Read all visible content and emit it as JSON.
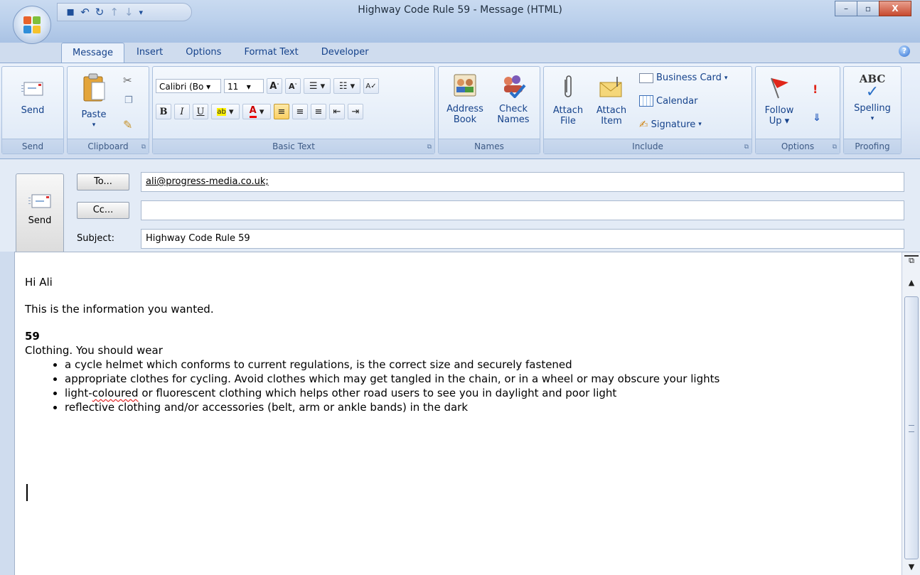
{
  "window": {
    "title": "Highway Code Rule 59 - Message (HTML)",
    "controls": {
      "minimize": "–",
      "maximize": "▫",
      "close": "X"
    }
  },
  "quick_access": {
    "save": "▪",
    "undo": "↶",
    "redo": "↻",
    "up": "↑",
    "down": "↓",
    "more": "▾"
  },
  "tabs": [
    "Message",
    "Insert",
    "Options",
    "Format Text",
    "Developer"
  ],
  "ribbon": {
    "send_group": {
      "send": "Send",
      "label": "Send"
    },
    "clipboard": {
      "paste": "Paste",
      "label": "Clipboard"
    },
    "basic_text": {
      "font": "Calibri (Bo",
      "size": "11",
      "bold": "B",
      "italic": "I",
      "underline": "U",
      "label": "Basic Text"
    },
    "names": {
      "address_book_1": "Address",
      "address_book_2": "Book",
      "check_names_1": "Check",
      "check_names_2": "Names",
      "label": "Names"
    },
    "include": {
      "attach_file_1": "Attach",
      "attach_file_2": "File",
      "attach_item_1": "Attach",
      "attach_item_2": "Item",
      "business_card": "Business Card",
      "calendar": "Calendar",
      "signature": "Signature",
      "label": "Include"
    },
    "options": {
      "follow_up_1": "Follow",
      "follow_up_2": "Up",
      "label": "Options"
    },
    "proofing": {
      "spelling": "Spelling",
      "abc": "ABC",
      "label": "Proofing"
    }
  },
  "header": {
    "send": "Send",
    "to_button": "To...",
    "cc_button": "Cc...",
    "subject_label": "Subject:",
    "to_value": "ali@progress-media.co.uk;",
    "cc_value": "",
    "subject_value": "Highway Code Rule 59"
  },
  "body": {
    "greeting": "Hi Ali",
    "intro": "This is the information you wanted.",
    "rule_number": "59",
    "lead": "Clothing. You should wear",
    "bullets": [
      "a cycle helmet which conforms to current regulations, is the correct size and securely fastened",
      "appropriate clothes for cycling. Avoid clothes which may get tangled in the chain, or in a wheel or may obscure your lights",
      "light-coloured or fluorescent clothing which helps other road users to see you in daylight and poor light",
      "reflective clothing and/or accessories (belt, arm or ankle bands) in the dark"
    ],
    "bullet3_prefix": "light-",
    "bullet3_misspelled": "coloured",
    "bullet3_rest": " or fluorescent clothing which helps other road users to see you in daylight and poor light"
  },
  "colors": {
    "ribbon_text": "#15428b",
    "accent": "#8ba8d0"
  }
}
